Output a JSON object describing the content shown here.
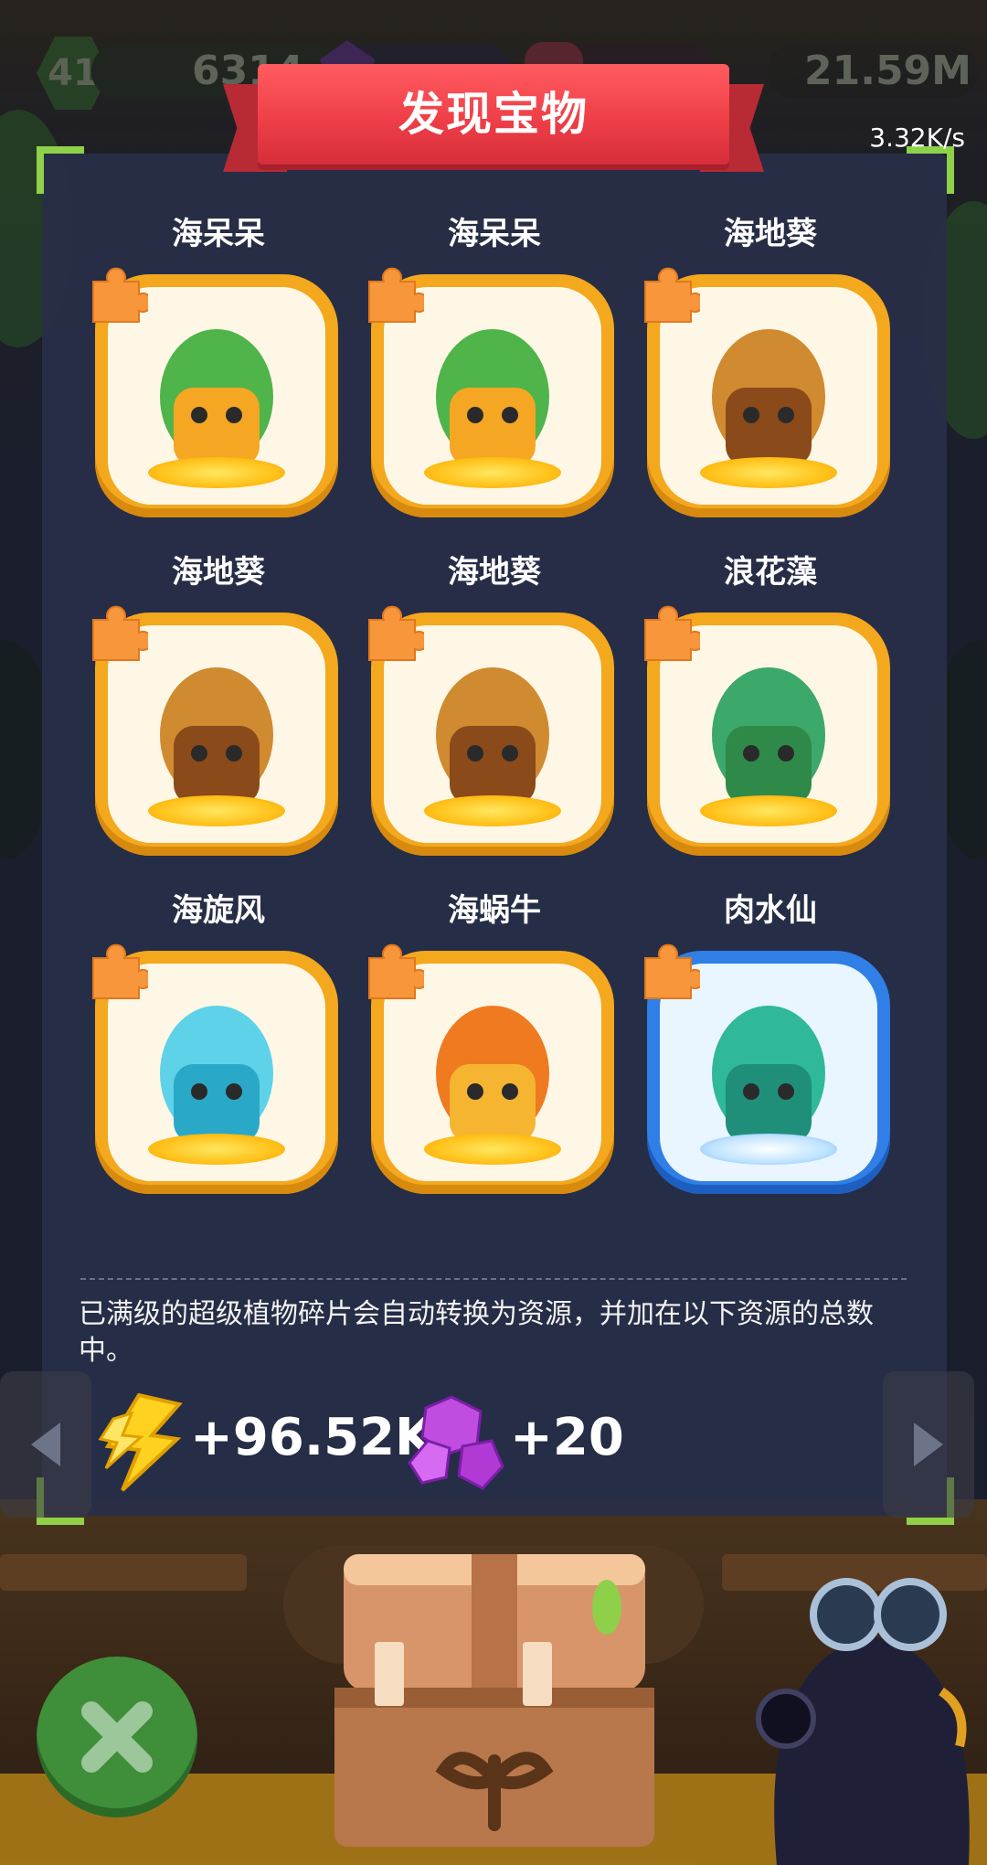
{
  "stats": {
    "level": "41",
    "leaves": "6314",
    "energy": "21.59M"
  },
  "dialog": {
    "title": "发现宝物",
    "rate": "3.32K/s"
  },
  "treasures": [
    {
      "name": "海呆呆",
      "frame": "gold"
    },
    {
      "name": "海呆呆",
      "frame": "gold"
    },
    {
      "name": "海地葵",
      "frame": "gold"
    },
    {
      "name": "海地葵",
      "frame": "gold"
    },
    {
      "name": "海地葵",
      "frame": "gold"
    },
    {
      "name": "浪花藻",
      "frame": "gold"
    },
    {
      "name": "海旋风",
      "frame": "gold"
    },
    {
      "name": "海蜗牛",
      "frame": "gold"
    },
    {
      "name": "肉水仙",
      "frame": "blue"
    }
  ],
  "info": {
    "message": "已满级的超级植物碎片会自动转换为资源，并加在以下资源的总数中。"
  },
  "rewards": {
    "energy": "+96.52K",
    "gems": "+20"
  },
  "colors": {
    "banner_red": "#ef3f48",
    "frame_gold": "#f3a81e",
    "frame_blue": "#2f7fe6",
    "corner_green": "#8fd14a"
  }
}
